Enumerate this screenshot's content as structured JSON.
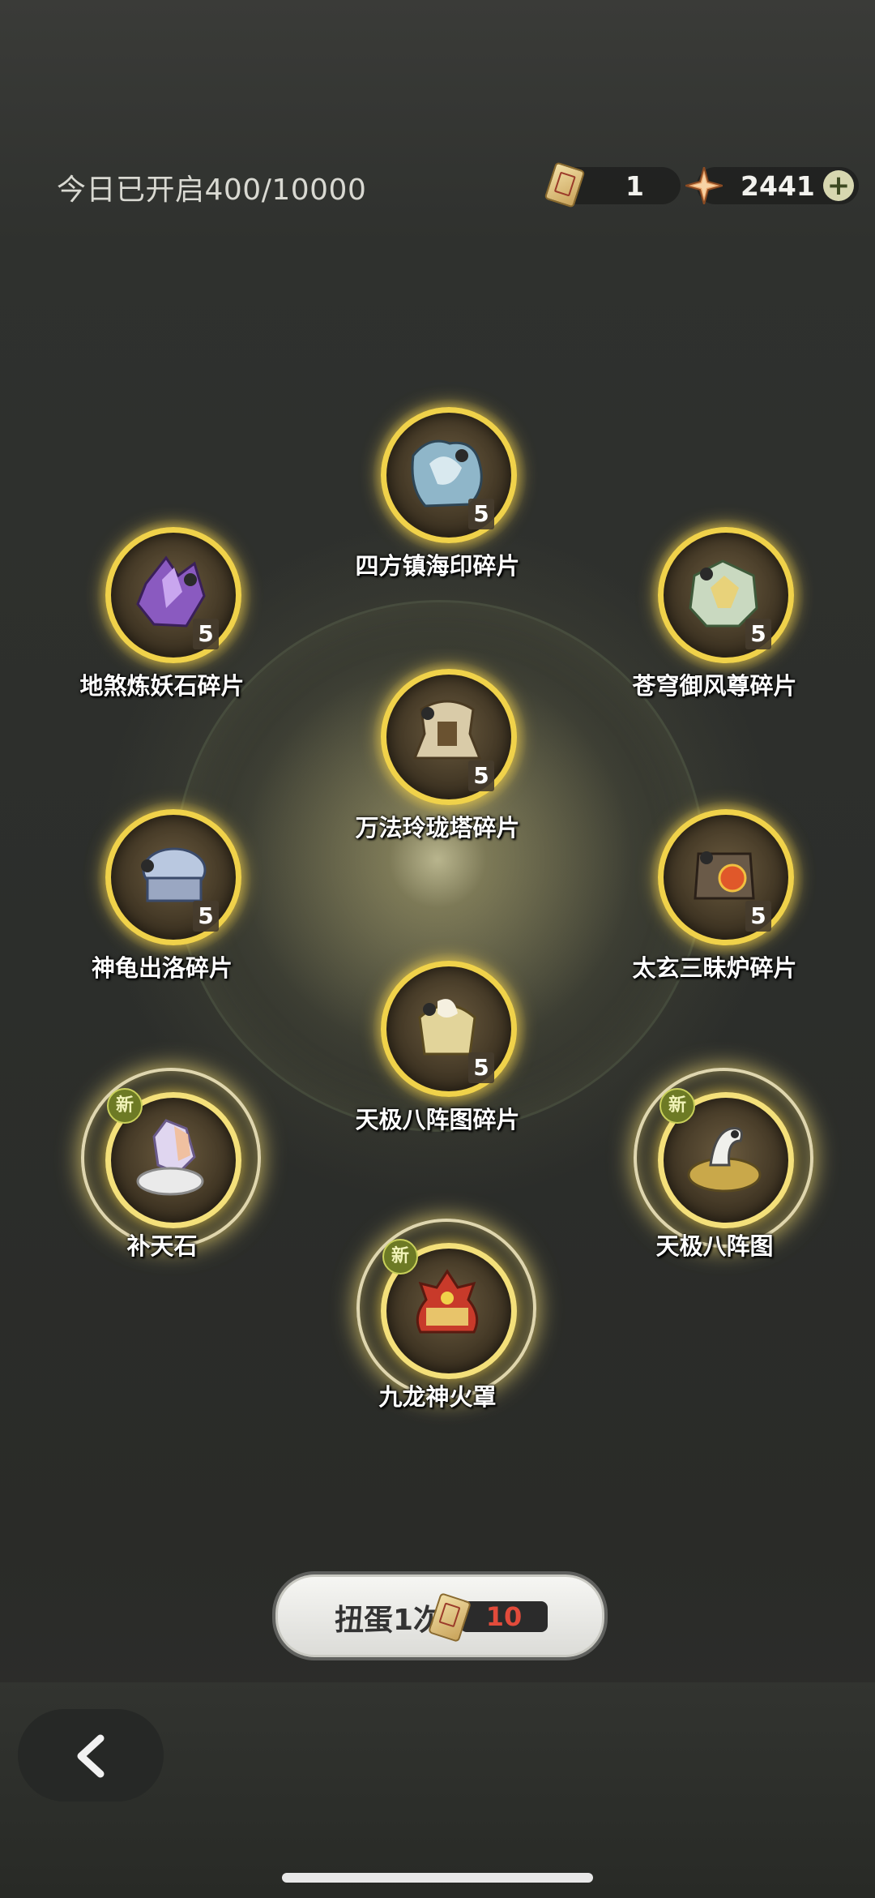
{
  "header": {
    "today_opened": "今日已开启400/10000",
    "ticket_count": "1",
    "star_count": "2441",
    "plus_label": "+"
  },
  "items": [
    {
      "name": "四方镇海印碎片",
      "count": "5"
    },
    {
      "name": "地煞炼妖石碎片",
      "count": "5"
    },
    {
      "name": "苍穹御风尊碎片",
      "count": "5"
    },
    {
      "name": "万法玲珑塔碎片",
      "count": "5"
    },
    {
      "name": "神龟出洛碎片",
      "count": "5"
    },
    {
      "name": "太玄三昧炉碎片",
      "count": "5"
    },
    {
      "name": "天极八阵图碎片",
      "count": "5"
    },
    {
      "name": "补天石",
      "badge": "新"
    },
    {
      "name": "天极八阵图",
      "badge": "新"
    },
    {
      "name": "九龙神火罩",
      "badge": "新"
    }
  ],
  "draw": {
    "label": "扭蛋1次",
    "cost": "10"
  },
  "colors": {
    "gold_ring": "#f0d24a",
    "cost_red": "#e24b3b",
    "badge_green": "#6d7a25"
  }
}
